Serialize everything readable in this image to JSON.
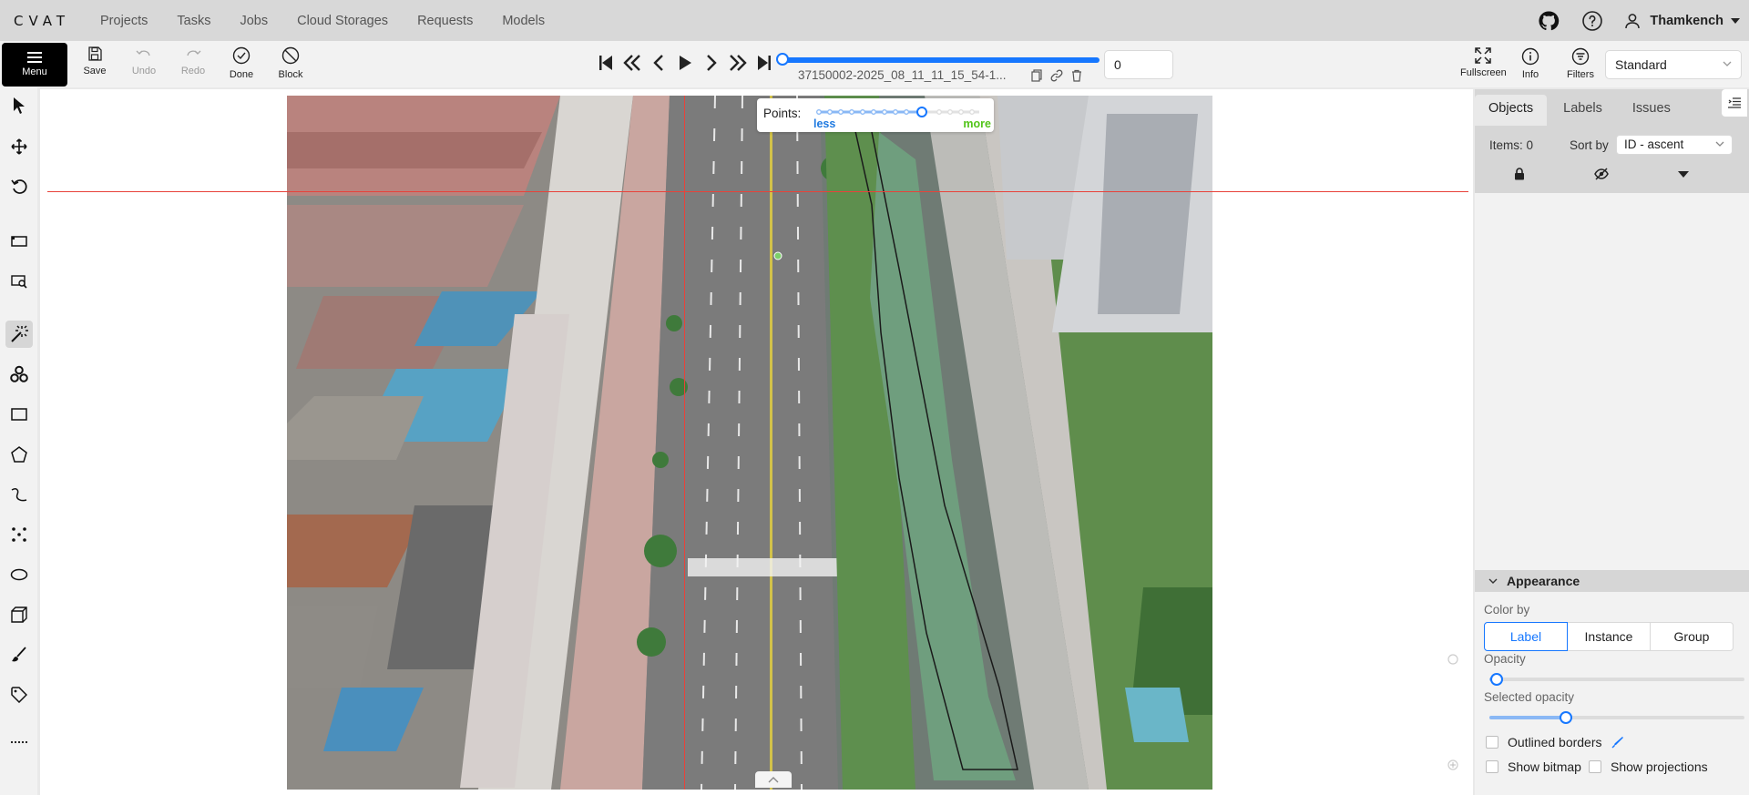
{
  "app": {
    "logo": "CVAT",
    "nav": [
      "Projects",
      "Tasks",
      "Jobs",
      "Cloud Storages",
      "Requests",
      "Models"
    ],
    "user": "Thamkench"
  },
  "toolbar": {
    "menu_label": "Menu",
    "save_label": "Save",
    "undo_label": "Undo",
    "redo_label": "Redo",
    "done_label": "Done",
    "block_label": "Block",
    "filename": "37150002-2025_08_11_11_15_54-1...",
    "frame_number": "0",
    "fullscreen_label": "Fullscreen",
    "info_label": "Info",
    "filters_label": "Filters",
    "workspace": "Standard",
    "frame_progress": 1.0
  },
  "canvas": {
    "points_label": "Points:",
    "less_label": "less",
    "more_label": "more"
  },
  "sidebar": {
    "tabs": [
      "Objects",
      "Labels",
      "Issues"
    ],
    "items_count": "Items: 0",
    "sort_label": "Sort by",
    "sort_value": "ID - ascent",
    "appearance": {
      "title": "Appearance",
      "color_by_label": "Color by",
      "color_by_options": [
        "Label",
        "Instance",
        "Group"
      ],
      "color_by_selected": "Label",
      "opacity_label": "Opacity",
      "opacity_value": 0.03,
      "selected_opacity_label": "Selected opacity",
      "selected_opacity_value": 0.3,
      "outlined_borders_label": "Outlined borders",
      "show_bitmap_label": "Show bitmap",
      "show_projections_label": "Show projections"
    }
  },
  "colors": {
    "accent": "#1677ff",
    "crosshair": "#e8423a",
    "more": "#52c41a"
  }
}
